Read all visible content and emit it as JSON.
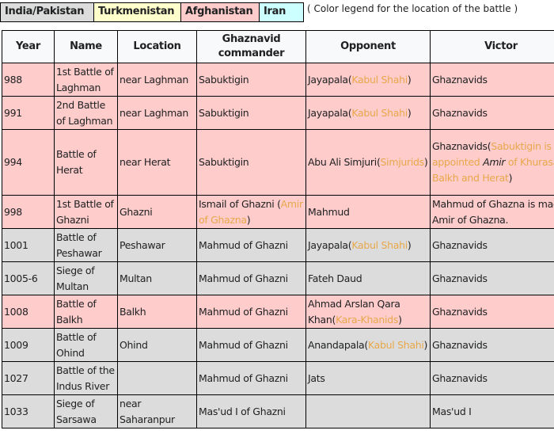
{
  "colors": {
    "india_pakistan": "#dcdcdc",
    "turkmenistan": "#ffffcc",
    "afghanistan": "#ffcccc",
    "iran": "#ccffff",
    "link": "#e8a84a",
    "header_bg": "#f8f9fa"
  },
  "legend": {
    "items": [
      {
        "label": "India/Pakistan",
        "color": "#dcdcdc"
      },
      {
        "label": "Turkmenistan",
        "color": "#ffffcc"
      },
      {
        "label": "Afghanistan",
        "color": "#ffcccc"
      },
      {
        "label": "Iran",
        "color": "#ccffff"
      }
    ],
    "note": "( Color legend for the location of the battle )"
  },
  "table": {
    "headers": [
      "Year",
      "Name",
      "Location",
      "Ghaznavid commander",
      "Opponent",
      "Victor"
    ],
    "rows": [
      {
        "region": "afghanistan",
        "year": "988",
        "name": "1st Battle of Laghman",
        "location": "near Laghman",
        "commander": [
          {
            "t": "Sabuktigin"
          }
        ],
        "opponent": [
          {
            "t": "Jayapala("
          },
          {
            "t": "Kabul Shahi",
            "link": true
          },
          {
            "t": ")"
          }
        ],
        "victor": [
          {
            "t": "Ghaznavids"
          }
        ]
      },
      {
        "region": "afghanistan",
        "year": "991",
        "name": "2nd Battle of Laghman",
        "location": "near Laghman",
        "commander": [
          {
            "t": "Sabuktigin"
          }
        ],
        "opponent": [
          {
            "t": "Jayapala("
          },
          {
            "t": "Kabul Shahi",
            "link": true
          },
          {
            "t": ")"
          }
        ],
        "victor": [
          {
            "t": "Ghaznavids"
          }
        ]
      },
      {
        "region": "afghanistan",
        "year": "994",
        "name": "Battle of Herat",
        "location": "near Herat",
        "commander": [
          {
            "t": "Sabuktigin"
          }
        ],
        "opponent": [
          {
            "t": "Abu Ali Simjuri("
          },
          {
            "t": "Simjurids",
            "link": true
          },
          {
            "t": ")"
          }
        ],
        "victor": [
          {
            "t": "Ghaznavids("
          },
          {
            "t": "Sabuktigin is appointed ",
            "link": true
          },
          {
            "t": "Amir",
            "italic": true
          },
          {
            "t": " of Khurasan, Balkh and Herat",
            "link": true
          },
          {
            "t": ")"
          }
        ]
      },
      {
        "region": "afghanistan",
        "year": "998",
        "name": "1st Battle of Ghazni",
        "location": "Ghazni",
        "commander": [
          {
            "t": "Ismail of Ghazni ("
          },
          {
            "t": "Amir of Ghazna",
            "link": true
          },
          {
            "t": ")"
          }
        ],
        "opponent": [
          {
            "t": "Mahmud"
          }
        ],
        "victor": [
          {
            "t": "Mahmud of Ghazna is made Amir of Ghazna."
          }
        ]
      },
      {
        "region": "india_pakistan",
        "year": "1001",
        "name": "Battle of Peshawar",
        "location": "Peshawar",
        "commander": [
          {
            "t": "Mahmud of Ghazni"
          }
        ],
        "opponent": [
          {
            "t": "Jayapala("
          },
          {
            "t": "Kabul Shahi",
            "link": true
          },
          {
            "t": ")"
          }
        ],
        "victor": [
          {
            "t": "Ghaznavids"
          }
        ]
      },
      {
        "region": "india_pakistan",
        "year": "1005-6",
        "name": "Siege of Multan",
        "location": "Multan",
        "commander": [
          {
            "t": "Mahmud of Ghazni"
          }
        ],
        "opponent": [
          {
            "t": "Fateh Daud"
          }
        ],
        "victor": [
          {
            "t": "Ghaznavids"
          }
        ]
      },
      {
        "region": "afghanistan",
        "year": "1008",
        "name": "Battle of Balkh",
        "location": "Balkh",
        "commander": [
          {
            "t": "Mahmud of Ghazni"
          }
        ],
        "opponent": [
          {
            "t": "Ahmad Arslan Qara Khan("
          },
          {
            "t": "Kara-Khanids",
            "link": true
          },
          {
            "t": ")"
          }
        ],
        "victor": [
          {
            "t": "Ghaznavids"
          }
        ]
      },
      {
        "region": "india_pakistan",
        "year": "1009",
        "name": "Battle of Ohind",
        "location": "Ohind",
        "commander": [
          {
            "t": "Mahmud of Ghazni"
          }
        ],
        "opponent": [
          {
            "t": "Anandapala("
          },
          {
            "t": "Kabul Shahi",
            "link": true
          },
          {
            "t": ")"
          }
        ],
        "victor": [
          {
            "t": "Ghaznavids"
          }
        ]
      },
      {
        "region": "india_pakistan",
        "year": "1027",
        "name": "Battle of the Indus River",
        "location": "",
        "commander": [
          {
            "t": "Mahmud of Ghazni"
          }
        ],
        "opponent": [
          {
            "t": "Jats"
          }
        ],
        "victor": [
          {
            "t": "Ghaznavids"
          }
        ]
      },
      {
        "region": "india_pakistan",
        "year": "1033",
        "name": "Siege of Sarsawa",
        "location": "near Saharanpur",
        "commander": [
          {
            "t": "Mas'ud I of Ghazni"
          }
        ],
        "opponent": [],
        "victor": [
          {
            "t": "Mas'ud I"
          }
        ]
      }
    ]
  }
}
